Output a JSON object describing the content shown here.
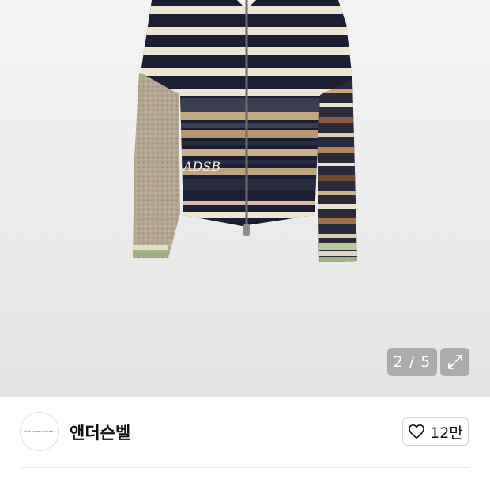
{
  "gallery": {
    "counter": "2 / 5",
    "current_index": 2,
    "total": 5,
    "image_alt": "striped knit zip-up cardigan with tweed sleeve",
    "overlay_color": "#969696"
  },
  "brand": {
    "logo_text": "ADER ANDERSSON BELL",
    "name": "앤더슨벨"
  },
  "like": {
    "count_label": "12만",
    "icon": "heart-outline-icon"
  },
  "icons": {
    "expand": "expand-arrows-icon",
    "heart": "heart-outline-icon"
  }
}
